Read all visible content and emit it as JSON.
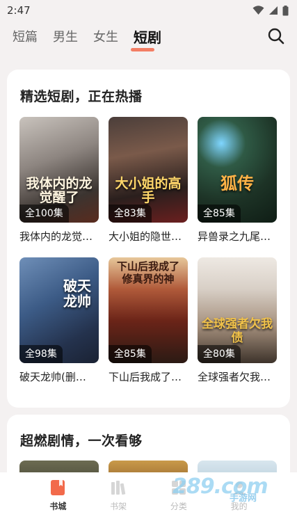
{
  "status": {
    "time": "2:47"
  },
  "tabs": [
    {
      "label": "短篇"
    },
    {
      "label": "男生"
    },
    {
      "label": "女生"
    },
    {
      "label": "短剧",
      "active": true
    }
  ],
  "featured": {
    "title": "精选短剧，正在热播",
    "items": [
      {
        "cover_text": "我体内的龙觉醒了",
        "episodes": "全100集",
        "title": "我体内的龙觉…"
      },
      {
        "cover_text": "大小姐的高手",
        "episodes": "全83集",
        "title": "大小姐的隐世…"
      },
      {
        "cover_text": "狐传",
        "episodes": "全85集",
        "title": "异兽录之九尾…"
      },
      {
        "cover_text": "破天龙帅",
        "episodes": "全98集",
        "title": "破天龙帅(删…"
      },
      {
        "cover_text": "下山后我成了修真界的神",
        "episodes": "全85集",
        "title": "下山后我成了…"
      },
      {
        "cover_text": "全球强者欠我债",
        "episodes": "全80集",
        "title": "全球强者欠我…"
      }
    ]
  },
  "second_section": {
    "title": "超燃剧情，一次看够"
  },
  "bottom_nav": [
    {
      "label": "书城",
      "icon": "book-icon",
      "active": true
    },
    {
      "label": "书架",
      "icon": "bookshelf-icon"
    },
    {
      "label": "分类",
      "icon": "category-icon"
    },
    {
      "label": "我的",
      "icon": "profile-icon"
    }
  ],
  "watermark": {
    "logo": "289.com",
    "sub": "手游网"
  },
  "colors": {
    "accent": "#f26a4b",
    "background": "#f4f1f1"
  }
}
